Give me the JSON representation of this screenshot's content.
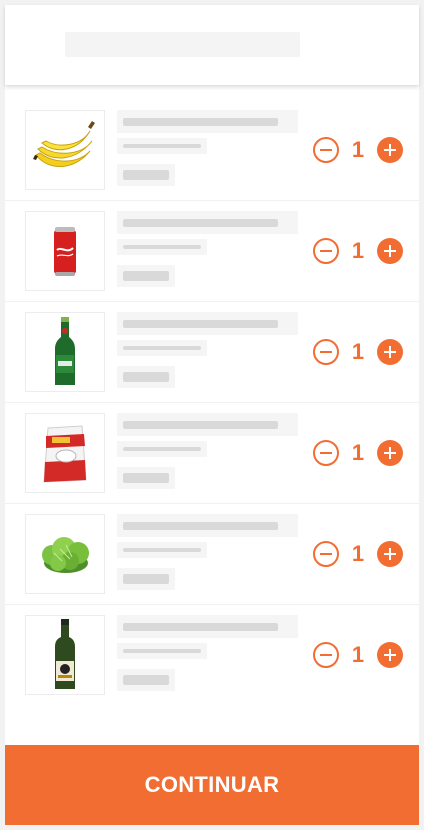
{
  "accent_color": "#f26d32",
  "items": [
    {
      "product": "banana",
      "icon": "banana-bunch-icon",
      "quantity": "1"
    },
    {
      "product": "coca-cola-can",
      "icon": "soda-can-icon",
      "quantity": "1"
    },
    {
      "product": "heineken-bottle",
      "icon": "beer-bottle-icon",
      "quantity": "1"
    },
    {
      "product": "tio-joao-rice",
      "icon": "rice-bag-icon",
      "quantity": "1"
    },
    {
      "product": "lettuce",
      "icon": "lettuce-icon",
      "quantity": "1"
    },
    {
      "product": "gallo-olive-oil",
      "icon": "olive-oil-bottle-icon",
      "quantity": "1"
    }
  ],
  "footer": {
    "continue_label": "CONTINUAR"
  }
}
